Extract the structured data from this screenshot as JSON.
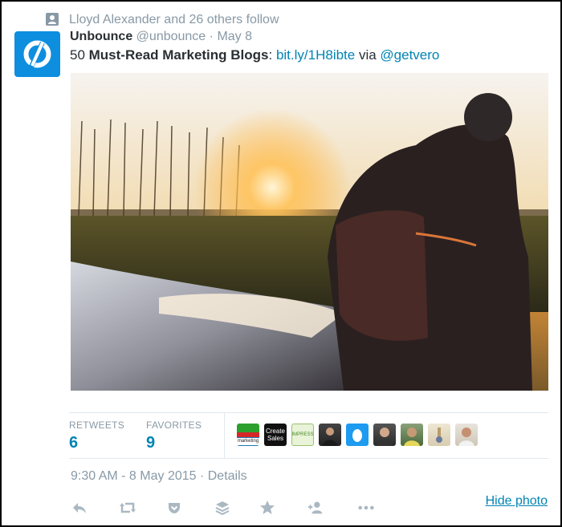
{
  "context": {
    "text": "Lloyd Alexander and 26 others follow",
    "icon": "person-icon"
  },
  "tweet": {
    "name": "Unbounce",
    "handle": "@unbounce",
    "separator": "·",
    "date": "May 8",
    "text_prefix": "50 ",
    "text_bold": "Must-Read Marketing Blogs",
    "text_colon": ": ",
    "link": "bit.ly/1H8ibte",
    "via": " via ",
    "mention": "@getvero"
  },
  "stats": {
    "retweets_label": "RETWEETS",
    "retweets_count": "6",
    "favorites_label": "FAVORITES",
    "favorites_count": "9",
    "favoriters": [
      {
        "text": "marketing"
      },
      {
        "text": "Create Sales"
      },
      {
        "text": "IMPRESS"
      },
      {
        "text": ""
      },
      {
        "text": ""
      },
      {
        "text": ""
      },
      {
        "text": ""
      },
      {
        "text": ""
      },
      {
        "text": ""
      }
    ]
  },
  "timestamp": "9:30 AM - 8 May 2015 · Details",
  "actions": {
    "reply": "reply-icon",
    "retweet": "retweet-icon",
    "pocket": "pocket-icon",
    "buffer": "buffer-icon",
    "favorite": "star-icon",
    "follow": "follow-icon",
    "more": "more-icon",
    "hide_photo": "Hide photo"
  },
  "colors": {
    "accent": "#0084b4",
    "muted": "#8899a6",
    "brand": "#0d8edf"
  }
}
